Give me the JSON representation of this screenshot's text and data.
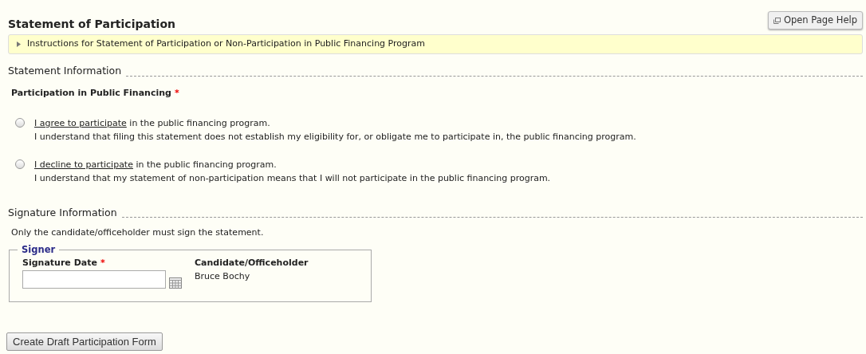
{
  "page_title": "Statement of Participation",
  "help_button": "Open Page Help",
  "instructions": {
    "text": "Instructions for Statement of Participation or Non-Participation in Public Financing Program",
    "expanded": false
  },
  "statement_section": {
    "heading": "Statement Information",
    "field_label": "Participation in Public Financing",
    "required_mark": "*",
    "options": [
      {
        "link": "I agree to participate",
        "rest": " in the public financing program.",
        "note": "I understand that filing this statement does not establish my eligibility for, or obligate me to participate in, the public financing program.",
        "selected": false
      },
      {
        "link": "I decline to participate",
        "rest": " in the public financing program.",
        "note": "I understand that my statement of non-participation means that I will not participate in the public financing program.",
        "selected": false
      }
    ]
  },
  "signature_section": {
    "heading": "Signature Information",
    "note": "Only the candidate/officeholder must sign the statement.",
    "signer": {
      "legend": "Signer",
      "date_label": "Signature Date",
      "required_mark": "*",
      "role_label": "Candidate/Officeholder",
      "role_value": "Bruce Bochy"
    }
  },
  "submit_button": "Create Draft Participation Form"
}
